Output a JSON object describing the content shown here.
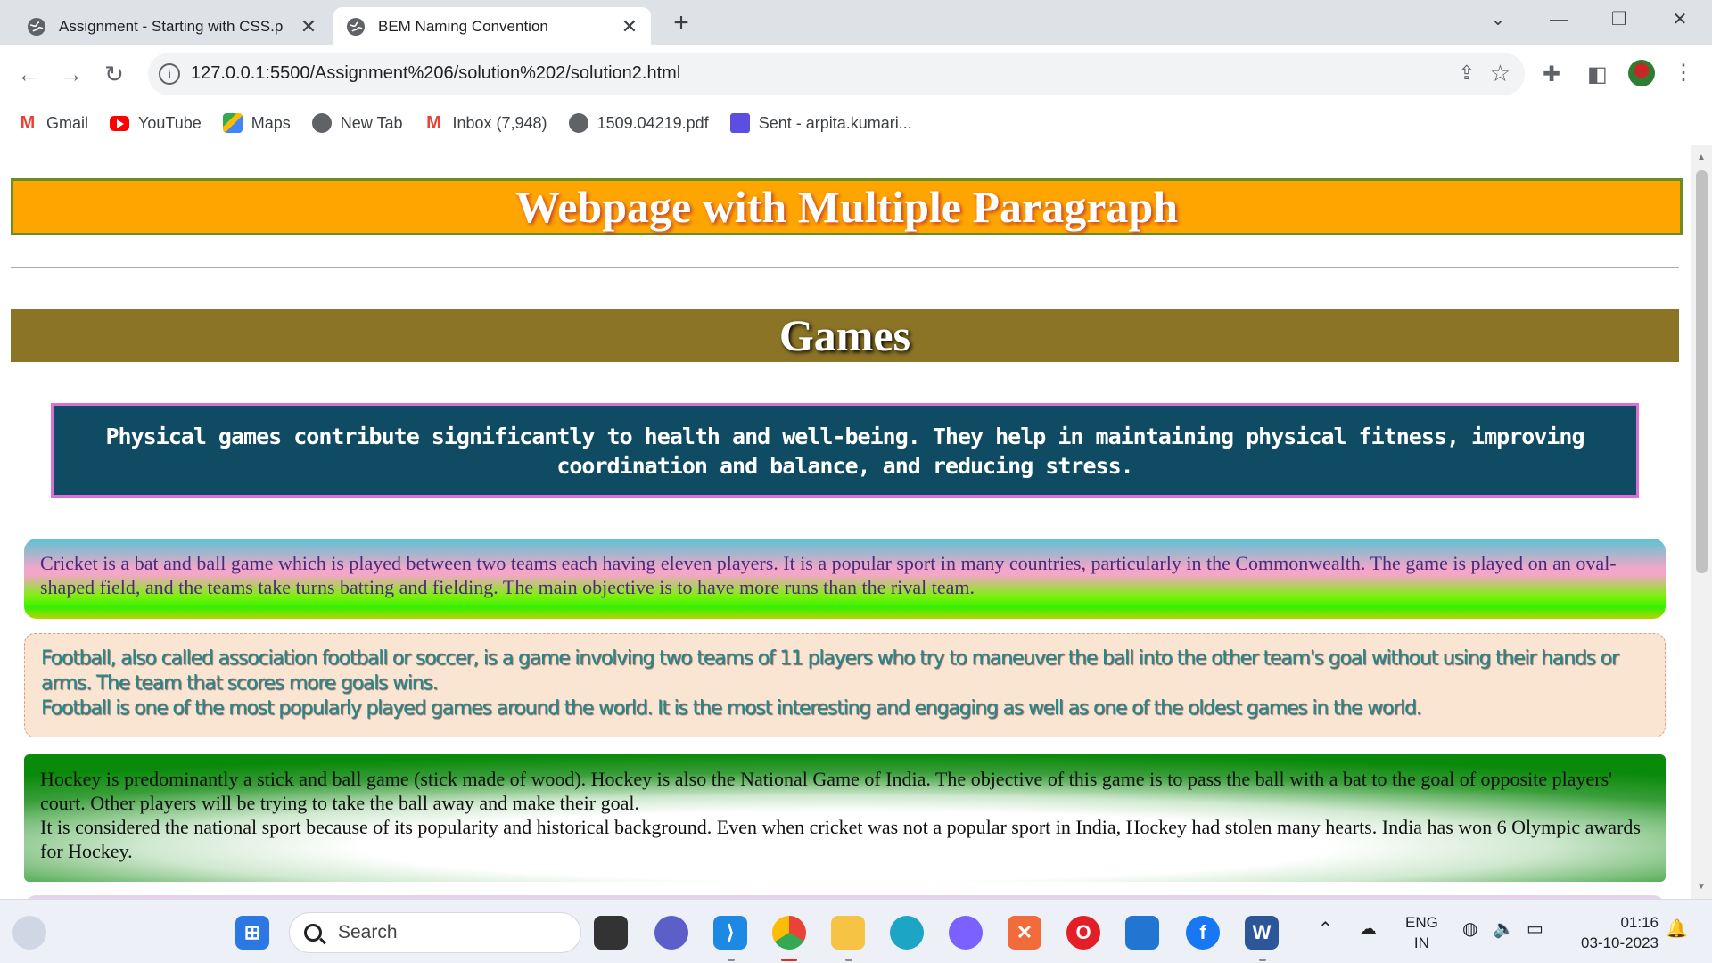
{
  "browser": {
    "tabs": [
      {
        "title": "Assignment - Starting with CSS.p",
        "active": false
      },
      {
        "title": "BEM Naming Convention",
        "active": true
      }
    ],
    "new_tab": "+",
    "url": "127.0.0.1:5500/Assignment%206/solution%202/solution2.html",
    "bookmarks": [
      {
        "label": "Gmail",
        "icon": "gmail-icon"
      },
      {
        "label": "YouTube",
        "icon": "youtube-icon"
      },
      {
        "label": "Maps",
        "icon": "maps-icon"
      },
      {
        "label": "New Tab",
        "icon": "globe-icon"
      },
      {
        "label": "Inbox (7,948)",
        "icon": "gmail-icon"
      },
      {
        "label": "1509.04219.pdf",
        "icon": "globe-icon"
      },
      {
        "label": "Sent - arpita.kumari...",
        "icon": "sent-icon"
      }
    ]
  },
  "page": {
    "title": "Webpage with Multiple Paragraph",
    "section_title": "Games",
    "intro": "Physical games contribute significantly to health and well-being. They help in maintaining physical fitness, improving coordination and balance, and reducing stress.",
    "cricket": "Cricket is a bat and ball game which is played between two teams each having eleven players. It is a popular sport in many countries, particularly in the Commonwealth. The game is played on an oval-shaped field, and the teams take turns batting and fielding. The main objective is to have more runs than the rival team.",
    "football_line1": "Football, also called association football or soccer, is a game involving two teams of 11 players who try to maneuver the ball into the other team's goal without using their hands or arms. The team that scores more goals wins.",
    "football_line2": "Football is one of the most popularly played games around the world. It is the most interesting and engaging as well as one of the oldest games in the world.",
    "hockey_line1": "Hockey is predominantly a stick and ball game (stick made of wood). Hockey is also the National Game of India. The objective of this game is to pass the ball with a bat to the goal of opposite players' court. Other players will be trying to take the ball away and make their goal.",
    "hockey_line2": "It is considered the national sport because of its popularity and historical background. Even when cricket was not a popular sport in India, Hockey had stolen many hearts. India has won 6 Olympic awards for Hockey."
  },
  "taskbar": {
    "search_placeholder": "Search",
    "lang_top": "ENG",
    "lang_bottom": "IN",
    "time": "01:16",
    "date": "03-10-2023"
  },
  "colors": {
    "title_bg": "#ffa500",
    "section_bg": "#8b7426",
    "intro_bg": "#0f4c63",
    "intro_border": "#da70d6"
  }
}
